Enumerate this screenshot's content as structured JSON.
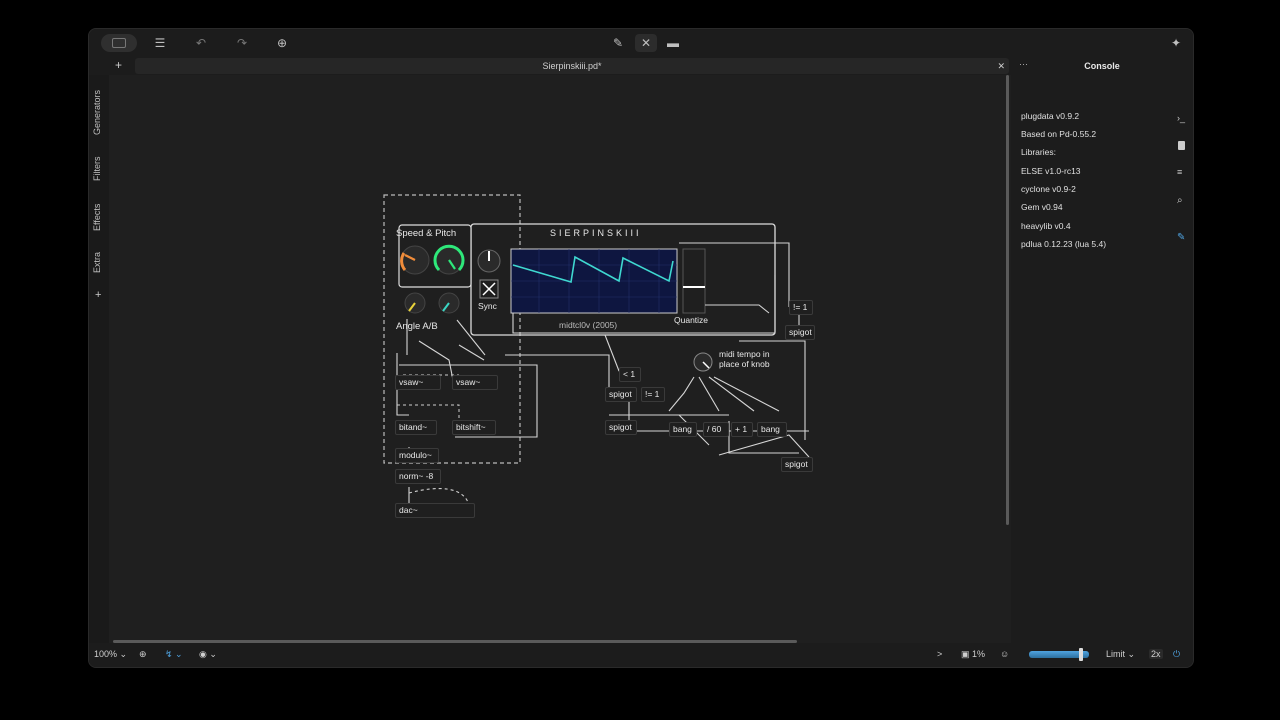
{
  "window": {
    "tab_title": "Sierpinskiii.pd*",
    "console_title": "Console"
  },
  "sidebar": {
    "items": [
      "Generators",
      "Filters",
      "Effects",
      "Extra"
    ],
    "add": "+"
  },
  "toolbar": {
    "new_tab": "+",
    "close_tab": "✕"
  },
  "console": {
    "lines": [
      "plugdata v0.9.2",
      "Based on Pd-0.55.2",
      "Libraries:",
      "ELSE v1.0-rc13",
      "cyclone v0.9-2",
      "Gem v0.94",
      "heavylib v0.4",
      "pdlua 0.12.23 (lua 5.4)"
    ]
  },
  "patch": {
    "title": "SIERPINSKIII",
    "speed_pitch": "Speed & Pitch",
    "angle": "Angle A/B",
    "sync": "Sync",
    "quantize": "Quantize",
    "midi_label": "midi tempo in\nplace of knob",
    "midi_caption": "midtcl0v (2005)",
    "objects": {
      "vsaw1": "vsaw~",
      "vsaw2": "vsaw~",
      "bitand": "bitand~",
      "bitshift": "bitshift~",
      "modulo": "modulo~",
      "norm": "norm~ -8",
      "dac": "dac~",
      "spigot1": "spigot",
      "spigot2": "spigot",
      "spigot3": "spigot",
      "spigot4": "spigot",
      "neq1": "!= 1",
      "neq2": "!= 1",
      "lt1": "< 1",
      "bang1": "bang",
      "div60": "/ 60",
      "plus1": "+ 1",
      "bang2": "bang"
    },
    "colors": {
      "knob_orange": "#f08c3a",
      "knob_green": "#2ee87a",
      "knob_yellow": "#e8d23a",
      "knob_teal": "#3ad6c4",
      "scope_bg": "#0e1640",
      "scope_wave": "#3fd8d0"
    }
  },
  "statusbar": {
    "zoom": "100%",
    "cpu": "1%",
    "limit": "Limit",
    "oversample": "2x",
    "console_toggle": ">"
  }
}
